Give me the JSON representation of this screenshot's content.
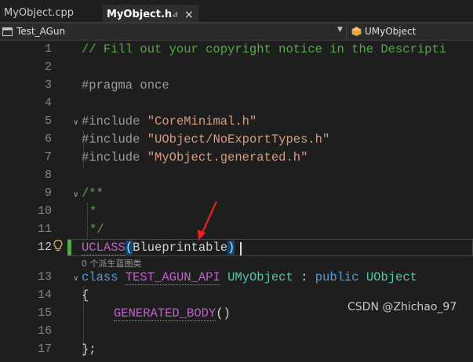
{
  "tabs": [
    {
      "label": "MyObject.cpp",
      "active": false
    },
    {
      "label": "MyObject.h",
      "active": true,
      "pin": "⊿",
      "close": "×"
    }
  ],
  "nav": {
    "project": "Test_AGun",
    "scope": "UMyObject"
  },
  "editor": {
    "current_line": 12,
    "line_numbers": [
      "1",
      "2",
      "3",
      "4",
      "5",
      "6",
      "7",
      "8",
      "9",
      "10",
      "11",
      "12",
      "13",
      "14",
      "15",
      "16",
      "17"
    ],
    "lines": {
      "l1": "// Fill out your copyright notice in the Descripti",
      "l3": "#pragma once",
      "l5_kw": "#include",
      "l5_str": "\"CoreMinimal.h\"",
      "l6_kw": "#include",
      "l6_str": "\"UObject/NoExportTypes.h\"",
      "l7_kw": "#include",
      "l7_str": "\"MyObject.generated.h\"",
      "l9": "/**",
      "l10": "*",
      "l11": "*/",
      "l12_macro": "UCLASS",
      "l12_open": "(",
      "l12_arg": "Blueprintable",
      "l12_close": ")",
      "l13_kw": "class",
      "l13_api": "TEST_AGUN_API",
      "l13_type": "UMyObject",
      "l13_colon": ":",
      "l13_public": "public",
      "l13_base": "UObject",
      "l14": "{",
      "l15": "GENERATED_BODY",
      "l15_parens": "()",
      "l17": "};"
    },
    "codelens": "0 个派生蓝图类"
  },
  "watermark": "CSDN @Zhichao_97",
  "colors": {
    "comment": "#57a64a",
    "keyword": "#569cd6",
    "macro": "#bd63c5",
    "type": "#4ec9b0",
    "string": "#d69d85",
    "arrow": "#e8231f"
  },
  "icons": [
    "project-icon",
    "class-icon",
    "lightbulb-icon",
    "pin-icon",
    "close-icon",
    "dropdown-icon",
    "fold-icon"
  ]
}
